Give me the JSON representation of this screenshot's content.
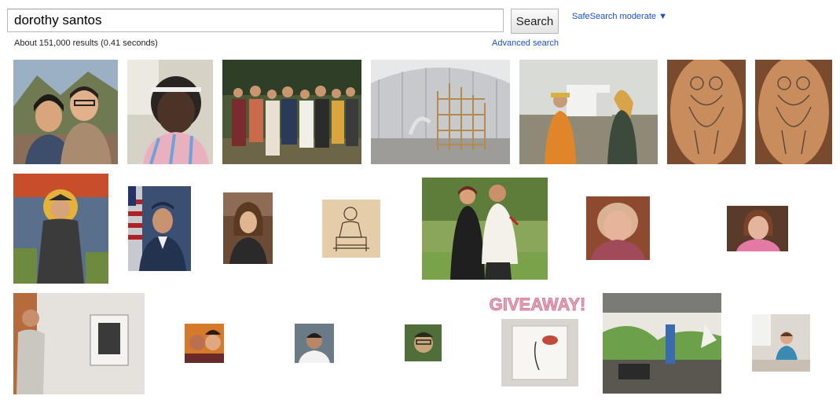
{
  "search": {
    "query": "dorothy santos",
    "button_label": "Search"
  },
  "safesearch": {
    "label": "SafeSearch moderate ▼"
  },
  "results": {
    "stats": "About 151,000 results (0.41 seconds)",
    "advanced_search_label": "Advanced search"
  },
  "images": [
    {
      "name": "couple-selfie"
    },
    {
      "name": "child-with-bow"
    },
    {
      "name": "family-group"
    },
    {
      "name": "warehouse-scaffold"
    },
    {
      "name": "landfill-handshake"
    },
    {
      "name": "back-tattoo-1"
    },
    {
      "name": "back-tattoo-2"
    },
    {
      "name": "mosaic-saint"
    },
    {
      "name": "military-portrait"
    },
    {
      "name": "woman-portrait"
    },
    {
      "name": "sketch-drawing"
    },
    {
      "name": "couple-garden"
    },
    {
      "name": "elderly-woman"
    },
    {
      "name": "girl-portrait"
    },
    {
      "name": "gallery-viewer"
    },
    {
      "name": "two-kids"
    },
    {
      "name": "man-headshot"
    },
    {
      "name": "green-portrait"
    },
    {
      "name": "giveaway-print",
      "text": "GIVEAWAY!"
    },
    {
      "name": "studio-interior"
    },
    {
      "name": "woman-at-desk"
    }
  ]
}
